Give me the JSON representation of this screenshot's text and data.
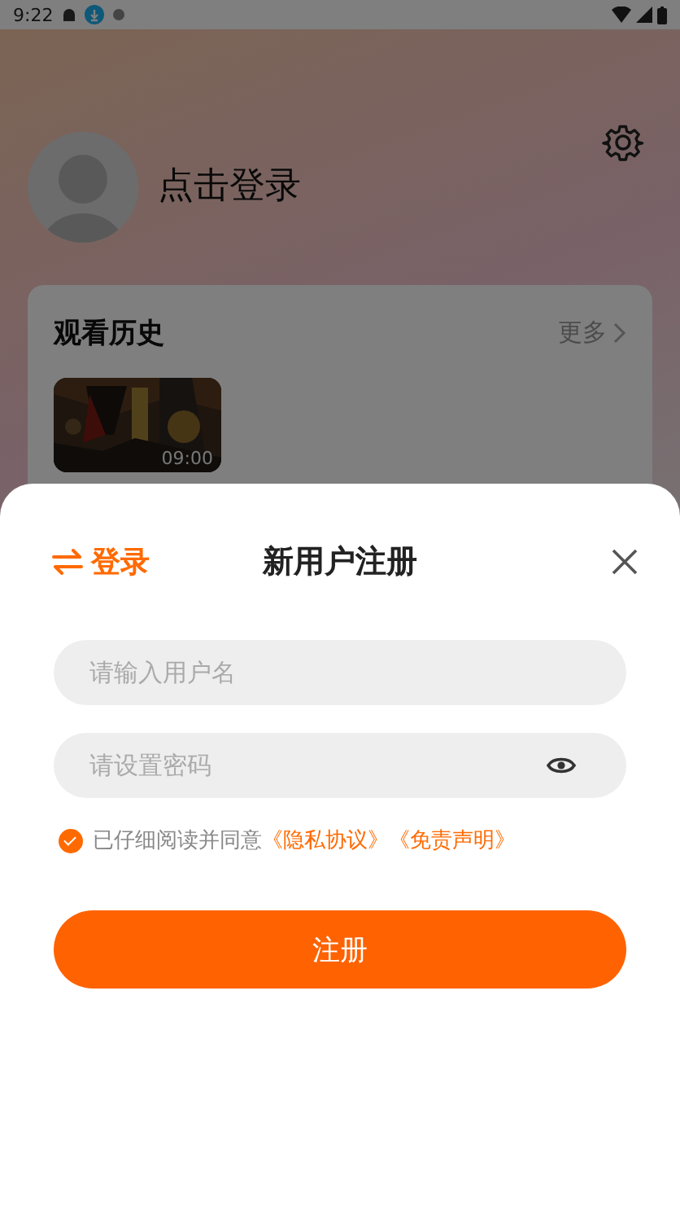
{
  "status_bar": {
    "time": "9:22"
  },
  "profile": {
    "login_prompt": "点击登录"
  },
  "history": {
    "title": "观看历史",
    "more": "更多",
    "items": [
      {
        "kind": "picture",
        "duration": "09:00"
      }
    ]
  },
  "register_sheet": {
    "switch_label": "登录",
    "title": "新用户注册",
    "fields": [
      {
        "kind": "text",
        "placeholder": "请输入用户名"
      },
      {
        "kind": "password",
        "placeholder": "请设置密码"
      }
    ],
    "agreement": {
      "checked": true,
      "text": "已仔细阅读并同意",
      "links": [
        "《隐私协议》",
        "《免责声明》"
      ]
    },
    "submit": "注册"
  }
}
